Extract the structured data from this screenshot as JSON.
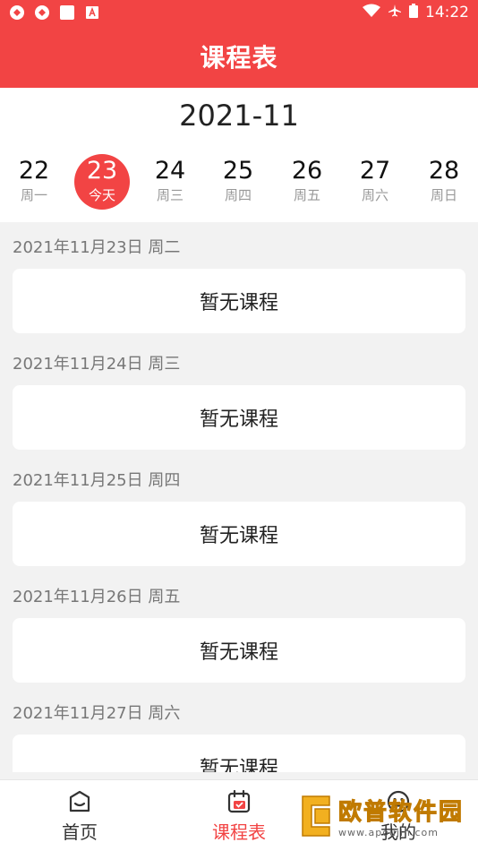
{
  "status": {
    "time": "14:22"
  },
  "appbar": {
    "title": "课程表"
  },
  "calendar": {
    "month": "2021-11",
    "days": [
      {
        "num": "22",
        "label": "周一",
        "active": false
      },
      {
        "num": "23",
        "label": "今天",
        "active": true
      },
      {
        "num": "24",
        "label": "周三",
        "active": false
      },
      {
        "num": "25",
        "label": "周四",
        "active": false
      },
      {
        "num": "26",
        "label": "周五",
        "active": false
      },
      {
        "num": "27",
        "label": "周六",
        "active": false
      },
      {
        "num": "28",
        "label": "周日",
        "active": false
      }
    ]
  },
  "sections": [
    {
      "date": "2021年11月23日 周二",
      "text": "暂无课程"
    },
    {
      "date": "2021年11月24日 周三",
      "text": "暂无课程"
    },
    {
      "date": "2021年11月25日 周四",
      "text": "暂无课程"
    },
    {
      "date": "2021年11月26日 周五",
      "text": "暂无课程"
    },
    {
      "date": "2021年11月27日 周六",
      "text": "暂无课程"
    }
  ],
  "tabs": [
    {
      "label": "首页",
      "icon": "home-face-icon"
    },
    {
      "label": "课程表",
      "icon": "calendar-check-icon"
    },
    {
      "label": "我的",
      "icon": "smiley-icon"
    }
  ],
  "watermark": {
    "cn": "欧普软件园",
    "en": "www.apoujin.com"
  },
  "colors": {
    "accent": "#f24444",
    "watermark": "#f2b020"
  }
}
